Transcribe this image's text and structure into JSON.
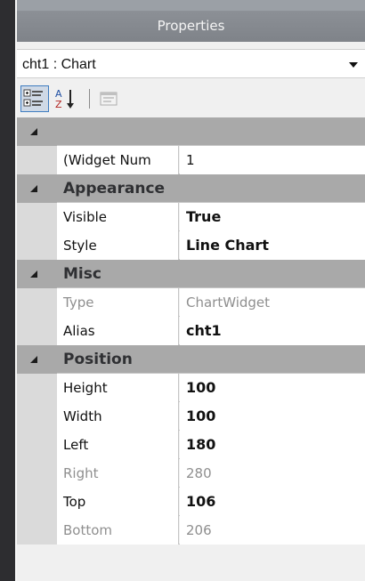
{
  "panel": {
    "title": "Properties"
  },
  "selector": {
    "object_name": "cht1",
    "object_type": "Chart",
    "display": "cht1 : Chart"
  },
  "toolbar": {
    "categorized_icon": "categorized-icon",
    "alphabetical_icon": "sort-az-icon",
    "property_pages_icon": "property-pages-icon"
  },
  "grid": {
    "rows": [
      {
        "kind": "category",
        "label": ""
      },
      {
        "kind": "property",
        "name": "(Widget Num",
        "value": "1",
        "bold": false,
        "disabled": false
      },
      {
        "kind": "category",
        "label": "Appearance"
      },
      {
        "kind": "property",
        "name": "Visible",
        "value": "True",
        "bold": true,
        "disabled": false
      },
      {
        "kind": "property",
        "name": "Style",
        "value": "Line Chart",
        "bold": true,
        "disabled": false
      },
      {
        "kind": "category",
        "label": "Misc"
      },
      {
        "kind": "property",
        "name": "Type",
        "value": "ChartWidget",
        "bold": false,
        "disabled": true
      },
      {
        "kind": "property",
        "name": "Alias",
        "value": "cht1",
        "bold": true,
        "disabled": false
      },
      {
        "kind": "category",
        "label": "Position"
      },
      {
        "kind": "property",
        "name": "Height",
        "value": "100",
        "bold": true,
        "disabled": false
      },
      {
        "kind": "property",
        "name": "Width",
        "value": "100",
        "bold": true,
        "disabled": false
      },
      {
        "kind": "property",
        "name": "Left",
        "value": "180",
        "bold": true,
        "disabled": false
      },
      {
        "kind": "property",
        "name": "Right",
        "value": "280",
        "bold": false,
        "disabled": true
      },
      {
        "kind": "property",
        "name": "Top",
        "value": "106",
        "bold": true,
        "disabled": false
      },
      {
        "kind": "property",
        "name": "Bottom",
        "value": "206",
        "bold": false,
        "disabled": true
      }
    ]
  }
}
